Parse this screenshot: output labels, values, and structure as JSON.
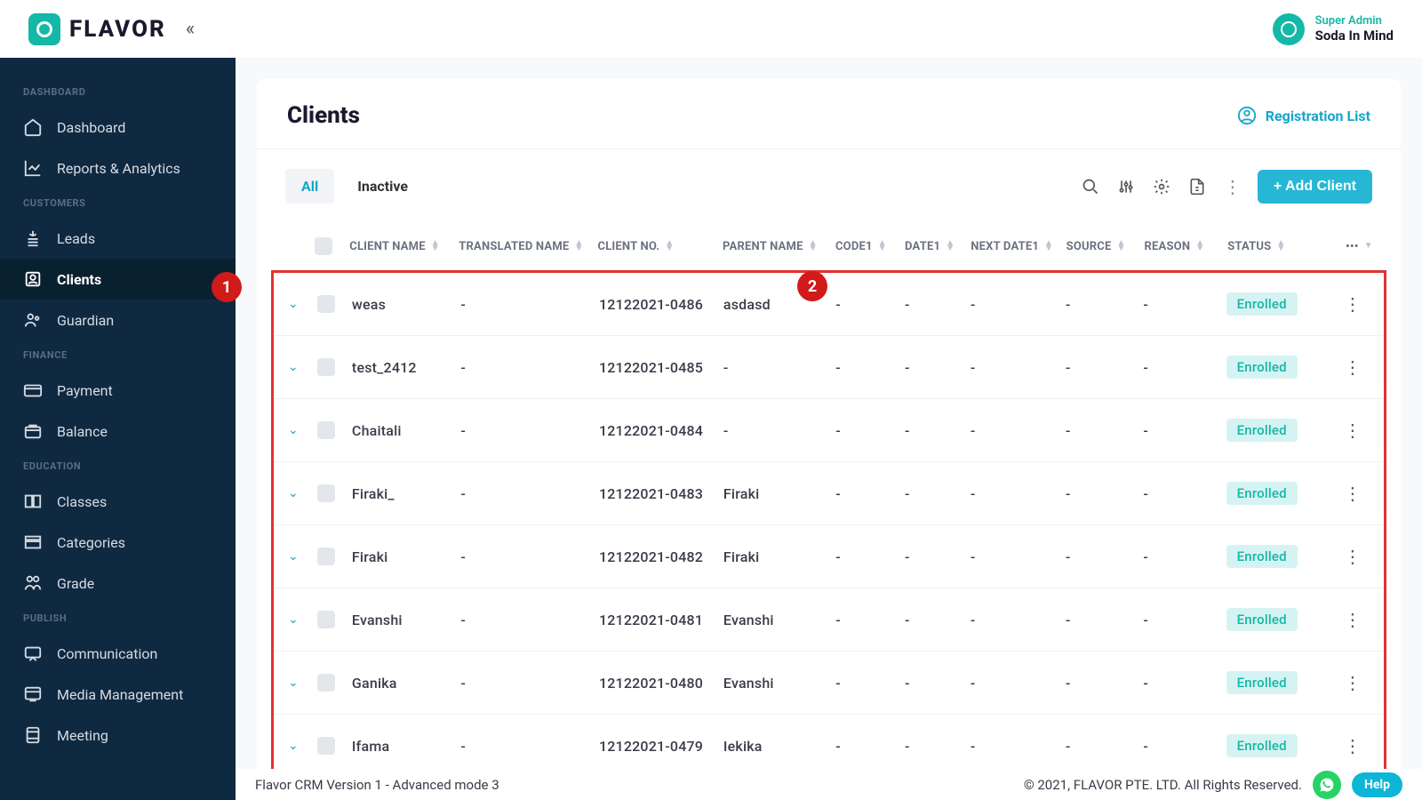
{
  "header": {
    "logo_text": "FLAVOR",
    "user_role": "Super Admin",
    "user_company": "Soda In Mind"
  },
  "sidebar": {
    "sections": [
      {
        "title": "DASHBOARD",
        "items": [
          {
            "label": "Dashboard",
            "icon": "home"
          },
          {
            "label": "Reports & Analytics",
            "icon": "chart"
          }
        ]
      },
      {
        "title": "CUSTOMERS",
        "items": [
          {
            "label": "Leads",
            "icon": "leads"
          },
          {
            "label": "Clients",
            "icon": "clients",
            "active": true
          },
          {
            "label": "Guardian",
            "icon": "guardian"
          }
        ]
      },
      {
        "title": "FINANCE",
        "items": [
          {
            "label": "Payment",
            "icon": "card"
          },
          {
            "label": "Balance",
            "icon": "balance"
          }
        ]
      },
      {
        "title": "EDUCATION",
        "items": [
          {
            "label": "Classes",
            "icon": "book"
          },
          {
            "label": "Categories",
            "icon": "categories"
          },
          {
            "label": "Grade",
            "icon": "grade"
          }
        ]
      },
      {
        "title": "PUBLISH",
        "items": [
          {
            "label": "Communication",
            "icon": "chat"
          },
          {
            "label": "Media Management",
            "icon": "media"
          },
          {
            "label": "Meeting",
            "icon": "meeting"
          }
        ]
      }
    ]
  },
  "page": {
    "title": "Clients",
    "reg_link": "Registration List",
    "tabs": {
      "all": "All",
      "inactive": "Inactive"
    },
    "add_btn": "+ Add Client"
  },
  "table": {
    "headers": {
      "client_name": "CLIENT NAME",
      "translated_name": "TRANSLATED NAME",
      "client_no": "CLIENT NO.",
      "parent_name": "PARENT NAME",
      "code1": "CODE1",
      "date1": "DATE1",
      "next_date1": "NEXT DATE1",
      "source": "SOURCE",
      "reason": "REASON",
      "status": "STATUS",
      "more": "•••"
    },
    "rows": [
      {
        "name": "weas",
        "trans": "-",
        "no": "12122021-0486",
        "parent": "asdasd",
        "code": "-",
        "date": "-",
        "next": "-",
        "source": "-",
        "reason": "-",
        "status": "Enrolled"
      },
      {
        "name": "test_2412",
        "trans": "-",
        "no": "12122021-0485",
        "parent": "-",
        "code": "-",
        "date": "-",
        "next": "-",
        "source": "-",
        "reason": "-",
        "status": "Enrolled"
      },
      {
        "name": "Chaitali",
        "trans": "-",
        "no": "12122021-0484",
        "parent": "-",
        "code": "-",
        "date": "-",
        "next": "-",
        "source": "-",
        "reason": "-",
        "status": "Enrolled"
      },
      {
        "name": "Firaki_",
        "trans": "-",
        "no": "12122021-0483",
        "parent": "Firaki",
        "code": "-",
        "date": "-",
        "next": "-",
        "source": "-",
        "reason": "-",
        "status": "Enrolled"
      },
      {
        "name": "Firaki",
        "trans": "-",
        "no": "12122021-0482",
        "parent": "Firaki",
        "code": "-",
        "date": "-",
        "next": "-",
        "source": "-",
        "reason": "-",
        "status": "Enrolled"
      },
      {
        "name": "Evanshi",
        "trans": "-",
        "no": "12122021-0481",
        "parent": "Evanshi",
        "code": "-",
        "date": "-",
        "next": "-",
        "source": "-",
        "reason": "-",
        "status": "Enrolled"
      },
      {
        "name": "Ganika",
        "trans": "-",
        "no": "12122021-0480",
        "parent": "Evanshi",
        "code": "-",
        "date": "-",
        "next": "-",
        "source": "-",
        "reason": "-",
        "status": "Enrolled"
      },
      {
        "name": "Ifama",
        "trans": "-",
        "no": "12122021-0479",
        "parent": "Iekika",
        "code": "-",
        "date": "-",
        "next": "-",
        "source": "-",
        "reason": "-",
        "status": "Enrolled"
      }
    ]
  },
  "markers": {
    "m1": "1",
    "m2": "2"
  },
  "footer": {
    "left": "Flavor CRM Version 1 - Advanced mode 3",
    "right": "© 2021, FLAVOR PTE. LTD. All Rights Reserved.",
    "help": "Help"
  }
}
